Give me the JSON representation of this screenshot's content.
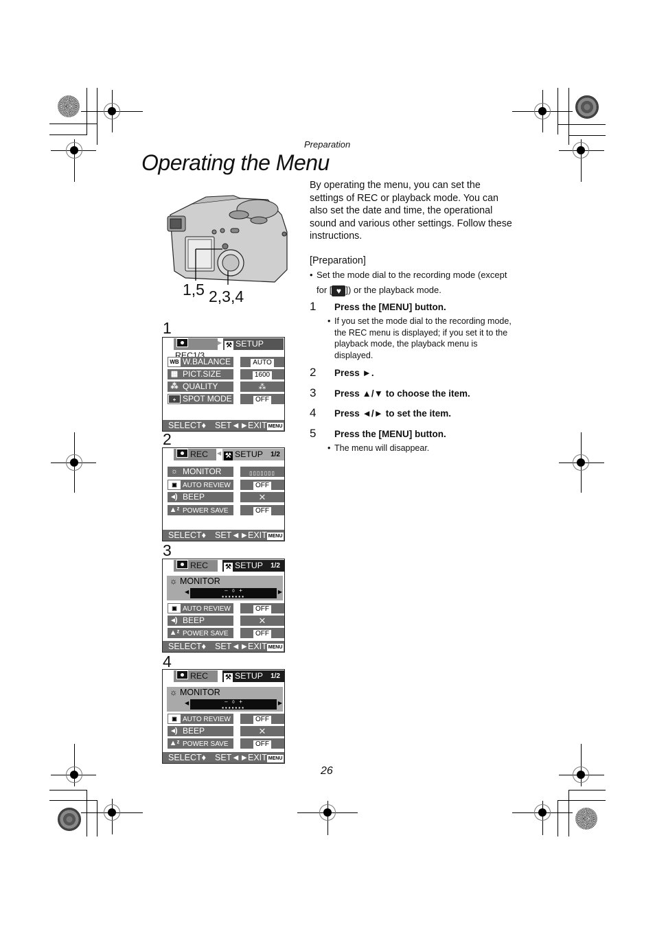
{
  "header": {
    "section": "Preparation",
    "title": "Operating the Menu"
  },
  "intro": "By operating the menu, you can set the settings of REC or playback mode. You can also set the date and time, the operational sound and various other settings. Follow these instructions.",
  "preparation": {
    "heading": "[Preparation]",
    "bullet_before": "Set the mode dial to the recording mode (except",
    "bullet_for": "for [",
    "bullet_icon": "heart-icon",
    "bullet_after": "]) or the playback mode."
  },
  "steps": [
    {
      "num": "1",
      "text": "Press the [MENU] button.",
      "note": "If you set the mode dial to the recording mode, the REC menu is displayed; if you set it to the playback mode, the playback menu is displayed."
    },
    {
      "num": "2",
      "text": "Press ►."
    },
    {
      "num": "3",
      "text": "Press ▲/▼ to choose the item."
    },
    {
      "num": "4",
      "text": "Press ◄/► to set the item."
    },
    {
      "num": "5",
      "text": "Press the [MENU] button.",
      "note": "The menu will disappear."
    }
  ],
  "camera_callouts": {
    "a": "1,5",
    "b": "2,3,4"
  },
  "panels": [
    {
      "num": "1",
      "tab_rec": "REC1/3",
      "tab_setup": "SETUP",
      "rows": [
        {
          "icon": "WB",
          "label": "W.BALANCE",
          "value": "AUTO"
        },
        {
          "icon": "size-icon",
          "label": "PICT.SIZE",
          "value": "1600"
        },
        {
          "icon": "quality-icon",
          "label": "QUALITY",
          "value": "quality-fine"
        },
        {
          "icon": "spot-icon",
          "label": "SPOT MODE",
          "value": "OFF"
        }
      ]
    },
    {
      "num": "2",
      "tab_rec": "REC",
      "tab_setup": "SETUP",
      "page": "1/2",
      "rows": [
        {
          "icon": "brightness-icon",
          "label": "MONITOR",
          "value": "meter"
        },
        {
          "icon": "review-icon",
          "label": "AUTO REVIEW",
          "value": "OFF"
        },
        {
          "icon": "beep-icon",
          "label": "BEEP",
          "value": "off-x"
        },
        {
          "icon": "power-save-icon",
          "label": "POWER SAVE",
          "value": "OFF"
        }
      ]
    },
    {
      "num": "3",
      "tab_rec": "REC",
      "tab_setup": "SETUP",
      "page": "1/2",
      "monitor_label": "MONITOR",
      "meter_level": 0,
      "rows": [
        {
          "icon": "review-icon",
          "label": "AUTO REVIEW",
          "value": "OFF"
        },
        {
          "icon": "beep-icon",
          "label": "BEEP",
          "value": "off-x"
        },
        {
          "icon": "power-save-icon",
          "label": "POWER SAVE",
          "value": "OFF"
        }
      ]
    },
    {
      "num": "4",
      "tab_rec": "REC",
      "tab_setup": "SETUP",
      "page": "1/2",
      "monitor_label": "MONITOR",
      "meter_level": 0,
      "rows": [
        {
          "icon": "review-icon",
          "label": "AUTO REVIEW",
          "value": "OFF"
        },
        {
          "icon": "beep-icon",
          "label": "BEEP",
          "value": "off-x"
        },
        {
          "icon": "power-save-icon",
          "label": "POWER SAVE",
          "value": "OFF"
        }
      ]
    }
  ],
  "footer": {
    "select": "SELECT♦",
    "set": "SET◄►",
    "exit": "EXIT",
    "menu_chip": "MENU"
  },
  "meter": {
    "minus": "–",
    "zero": "0",
    "plus": "+"
  },
  "page_number": "26"
}
